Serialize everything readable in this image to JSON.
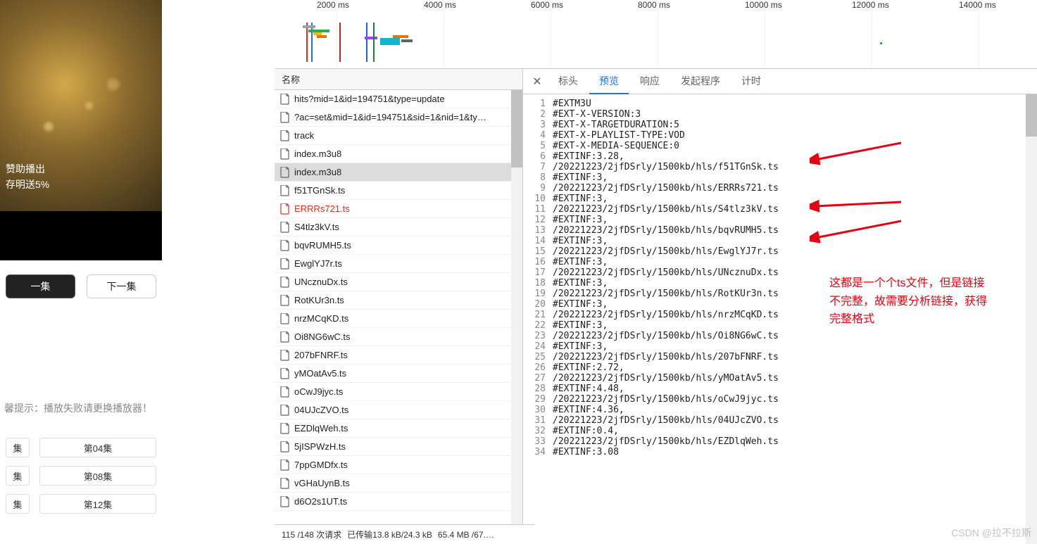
{
  "video": {
    "overlay_line1": "赞助播出",
    "overlay_line2": "存明送5%",
    "prev_btn": "一集",
    "next_btn": "下一集",
    "hint": "馨提示：播放失败请更换播放器！",
    "episodes": [
      [
        "集",
        "第04集"
      ],
      [
        "集",
        "第08集"
      ],
      [
        "集",
        "第12集"
      ]
    ]
  },
  "timeline_ticks": [
    "2000 ms",
    "4000 ms",
    "6000 ms",
    "8000 ms",
    "10000 ms",
    "12000 ms",
    "14000 ms"
  ],
  "req_header": "名称",
  "requests": [
    {
      "name": "hits?mid=1&id=194751&type=update"
    },
    {
      "name": "?ac=set&mid=1&id=194751&sid=1&nid=1&ty…"
    },
    {
      "name": "track"
    },
    {
      "name": "index.m3u8"
    },
    {
      "name": "index.m3u8",
      "selected": true
    },
    {
      "name": "f51TGnSk.ts"
    },
    {
      "name": "ERRRs721.ts",
      "error": true
    },
    {
      "name": "S4tlz3kV.ts"
    },
    {
      "name": "bqvRUMH5.ts"
    },
    {
      "name": "EwglYJ7r.ts"
    },
    {
      "name": "UNcznuDx.ts"
    },
    {
      "name": "RotKUr3n.ts"
    },
    {
      "name": "nrzMCqKD.ts"
    },
    {
      "name": "Oi8NG6wC.ts"
    },
    {
      "name": "207bFNRF.ts"
    },
    {
      "name": "yMOatAv5.ts"
    },
    {
      "name": "oCwJ9jyc.ts"
    },
    {
      "name": "04UJcZVO.ts"
    },
    {
      "name": "EZDlqWeh.ts"
    },
    {
      "name": "5jISPWzH.ts"
    },
    {
      "name": "7ppGMDfx.ts"
    },
    {
      "name": "vGHaUynB.ts"
    },
    {
      "name": "d6O2s1UT.ts"
    }
  ],
  "tabs": {
    "headers": "标头",
    "preview": "预览",
    "response": "响应",
    "initiator": "发起程序",
    "timing": "计时"
  },
  "preview_lines": [
    "#EXTM3U",
    "#EXT-X-VERSION:3",
    "#EXT-X-TARGETDURATION:5",
    "#EXT-X-PLAYLIST-TYPE:VOD",
    "#EXT-X-MEDIA-SEQUENCE:0",
    "#EXTINF:3.28,",
    "/20221223/2jfDSrly/1500kb/hls/f51TGnSk.ts",
    "#EXTINF:3,",
    "/20221223/2jfDSrly/1500kb/hls/ERRRs721.ts",
    "#EXTINF:3,",
    "/20221223/2jfDSrly/1500kb/hls/S4tlz3kV.ts",
    "#EXTINF:3,",
    "/20221223/2jfDSrly/1500kb/hls/bqvRUMH5.ts",
    "#EXTINF:3,",
    "/20221223/2jfDSrly/1500kb/hls/EwglYJ7r.ts",
    "#EXTINF:3,",
    "/20221223/2jfDSrly/1500kb/hls/UNcznuDx.ts",
    "#EXTINF:3,",
    "/20221223/2jfDSrly/1500kb/hls/RotKUr3n.ts",
    "#EXTINF:3,",
    "/20221223/2jfDSrly/1500kb/hls/nrzMCqKD.ts",
    "#EXTINF:3,",
    "/20221223/2jfDSrly/1500kb/hls/Oi8NG6wC.ts",
    "#EXTINF:3,",
    "/20221223/2jfDSrly/1500kb/hls/207bFNRF.ts",
    "#EXTINF:2.72,",
    "/20221223/2jfDSrly/1500kb/hls/yMOatAv5.ts",
    "#EXTINF:4.48,",
    "/20221223/2jfDSrly/1500kb/hls/oCwJ9jyc.ts",
    "#EXTINF:4.36,",
    "/20221223/2jfDSrly/1500kb/hls/04UJcZVO.ts",
    "#EXTINF:0.4,",
    "/20221223/2jfDSrly/1500kb/hls/EZDlqWeh.ts",
    "#EXTINF:3.08"
  ],
  "annotation": {
    "line1": "这都是一个个ts文件，但是链接",
    "line2": "不完整，故需要分析链接，获得",
    "line3": "完整格式"
  },
  "status": {
    "requests": "115 /148 次请求",
    "transfer": "已传输13.8 kB/24.3 kB",
    "resources": "65.4 MB /67.…"
  },
  "watermark": "CSDN @拉不拉斯"
}
